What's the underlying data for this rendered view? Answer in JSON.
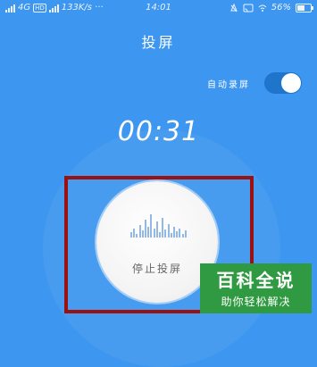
{
  "status_bar": {
    "carrier": "4G",
    "hd": "HD",
    "net_speed": "133K/s",
    "more": "···",
    "time": "14:01",
    "battery": "56%",
    "battery_level": 0.56
  },
  "title": "投屏",
  "auto_record": {
    "label": "自动录屏",
    "on": true
  },
  "timer": "00:31",
  "stop_button": {
    "label": "停止投屏",
    "waveform": [
      6,
      10,
      4,
      14,
      8,
      20,
      12,
      26,
      10,
      18,
      6,
      22,
      9,
      15,
      5,
      12,
      7,
      10,
      4,
      8
    ]
  },
  "colors": {
    "background": "#3d96ef",
    "highlight": "#9b1010",
    "watermark": "#2f9a41"
  },
  "watermark": {
    "main": "百科全说",
    "sub": "助你轻松解决"
  }
}
